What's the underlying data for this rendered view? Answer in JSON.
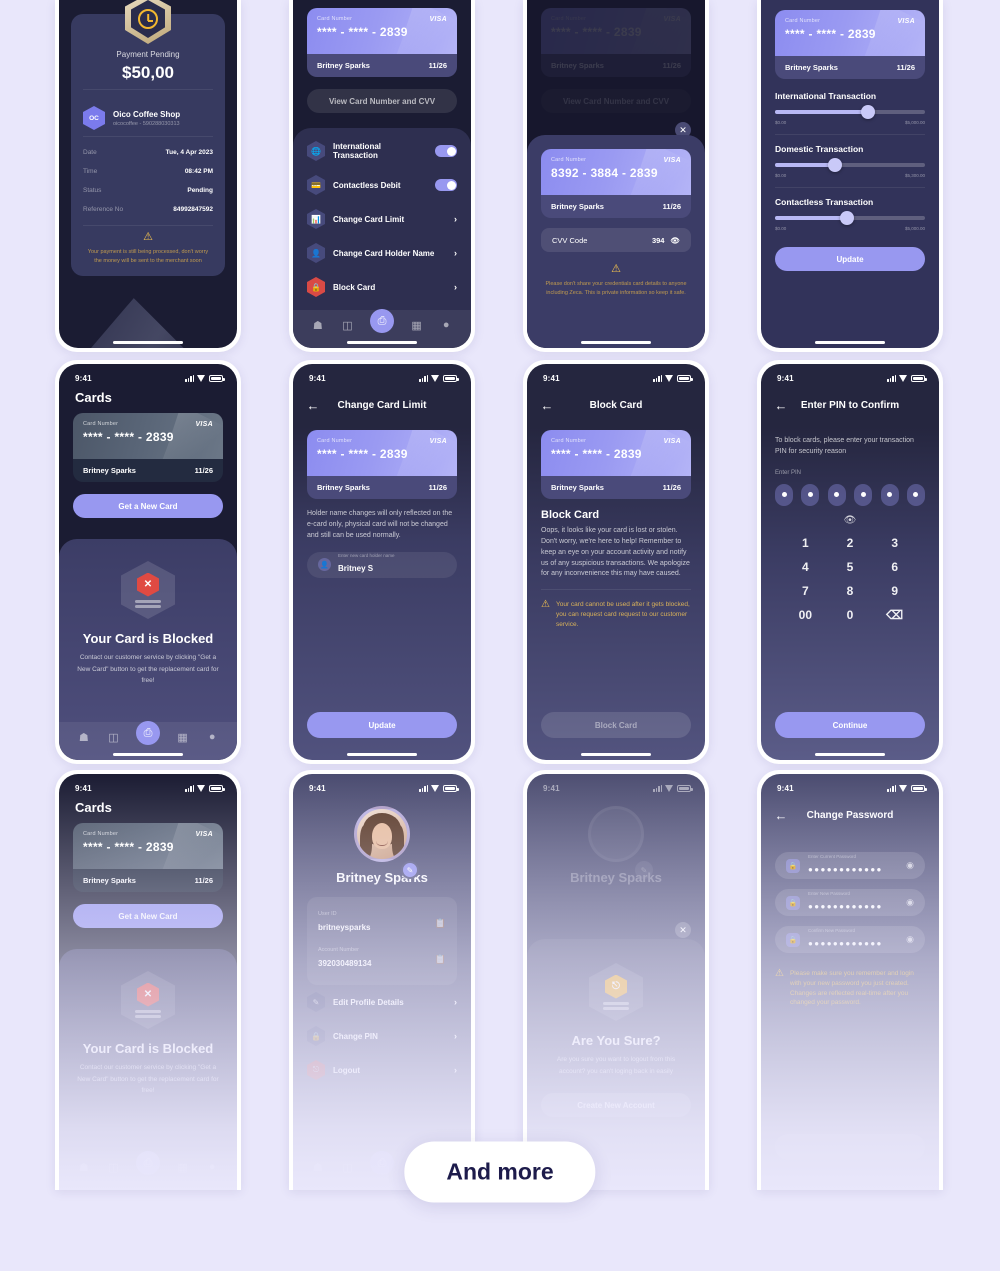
{
  "page": {
    "background": "#e9e7fb",
    "accent": "#9898f0",
    "and_more_label": "And more"
  },
  "common": {
    "status_time": "9:41",
    "card": {
      "label": "Card Number",
      "masked_number": "**** - **** - 2839",
      "holder": "Britney Sparks",
      "expiry": "11/26",
      "brand": "VISA"
    }
  },
  "screens": [
    {
      "id": "payment-pending",
      "receipt": {
        "status": "Payment Pending",
        "amount": "$50,00",
        "merchant_logo": "OC",
        "merchant_name": "Oico Coffee Shop",
        "merchant_sub": "oicocoffee - 590288030313",
        "rows": [
          {
            "key": "Date",
            "value": "Tue, 4 Apr 2023"
          },
          {
            "key": "Time",
            "value": "08:42 PM"
          },
          {
            "key": "Status",
            "value": "Pending"
          },
          {
            "key": "Reference No",
            "value": "84992847592"
          }
        ],
        "note": "Your payment is still being processed, don't worry the money will be sent to the merchant soon"
      }
    },
    {
      "id": "card-settings",
      "view_cvv_button": "View Card Number and CVV",
      "settings": [
        {
          "label": "International Transaction",
          "icon": "globe-icon",
          "control": "toggle",
          "on": true
        },
        {
          "label": "Contactless Debit",
          "icon": "contactless-icon",
          "control": "toggle",
          "on": true
        },
        {
          "label": "Change Card Limit",
          "icon": "chart-icon",
          "control": "chevron"
        },
        {
          "label": "Change Card Holder Name",
          "icon": "user-card-icon",
          "control": "chevron"
        },
        {
          "label": "Block Card",
          "icon": "block-icon",
          "control": "chevron",
          "danger": true
        }
      ],
      "tabs": [
        {
          "name": "home-icon",
          "glyph": "⌂"
        },
        {
          "name": "transactions-icon",
          "glyph": "≣"
        },
        {
          "name": "scan-icon",
          "glyph": "⬚"
        },
        {
          "name": "cards-icon",
          "glyph": "▤"
        },
        {
          "name": "profile-icon",
          "glyph": "●"
        }
      ]
    },
    {
      "id": "view-card-cvv",
      "view_cvv_button": "View Card Number and CVV",
      "revealed_number": "8392 - 3884 - 2839",
      "cvv_label": "CVV Code",
      "cvv_value": "394",
      "close_icon": "close-icon",
      "eye_icon": "eye-off-icon",
      "warning": "Please don't share your credentials card details to anyone including Zeca. This is private information so keep it safe."
    },
    {
      "id": "change-card-limit-sliders",
      "sliders": [
        {
          "title": "International Transaction",
          "min": "$0.00",
          "max": "$5,000.00",
          "position": 62
        },
        {
          "title": "Domestic Transaction",
          "min": "$0.00",
          "max": "$5,300.00",
          "position": 40
        },
        {
          "title": "Contactless Transaction",
          "min": "$0.00",
          "max": "$5,000.00",
          "position": 48
        }
      ],
      "update_button": "Update"
    },
    {
      "id": "cards-blocked",
      "page_title": "Cards",
      "get_new_card_button": "Get a New Card",
      "blocked_title": "Your Card is Blocked",
      "blocked_desc": "Contact our customer service by clicking \"Get a New Card\" button to get the replacement card for free!"
    },
    {
      "id": "change-card-limit",
      "nav_title": "Change Card Limit",
      "back_icon": "arrow-left-icon",
      "body": "Holder name changes will only reflected on the e-card only, physical card will not be changed and still can be used normally.",
      "input_placeholder": "Enter new card holder name",
      "input_value": "Britney S",
      "input_icon": "user-icon",
      "update_button": "Update"
    },
    {
      "id": "block-card",
      "nav_title": "Block Card",
      "back_icon": "arrow-left-icon",
      "heading": "Block Card",
      "body": "Oops, it looks like your card is lost or stolen. Don't worry, we're here to help! Remember to keep an eye on your account activity and notify us of any suspicious transactions. We apologize for any inconvenience this may have caused.",
      "warning": "Your card cannot be used after it gets blocked, you can request card request to our customer service.",
      "block_button": "Block Card"
    },
    {
      "id": "enter-pin",
      "nav_title": "Enter PIN to Confirm",
      "back_icon": "arrow-left-icon",
      "instruction": "To block cards, please enter your transaction PIN for security reason",
      "field_label": "Enter PIN",
      "pin_length": 6,
      "eye_icon": "eye-icon",
      "keypad": [
        "1",
        "2",
        "3",
        "4",
        "5",
        "6",
        "7",
        "8",
        "9",
        "00",
        "0",
        "⌫"
      ],
      "continue_button": "Continue"
    },
    {
      "id": "cards-blocked-faded",
      "page_title": "Cards",
      "get_new_card_button": "Get a New Card",
      "blocked_title": "Your Card is Blocked",
      "blocked_desc": "Contact our customer service by clicking \"Get a New Card\" button to get the replacement card for free!"
    },
    {
      "id": "profile",
      "name": "Britney Sparks",
      "edit_icon": "pencil-icon",
      "info": [
        {
          "key": "User ID",
          "value": "britneysparks",
          "action_icon": "copy-icon"
        },
        {
          "key": "Account Number",
          "value": "392030489134",
          "action_icon": "copy-icon"
        }
      ],
      "menu": [
        {
          "label": "Edit Profile Details",
          "icon": "pencil-icon"
        },
        {
          "label": "Change PIN",
          "icon": "lock-icon"
        },
        {
          "label": "Logout",
          "icon": "logout-icon"
        }
      ]
    },
    {
      "id": "logout-confirm",
      "name": "Britney Sparks",
      "close_icon": "close-icon",
      "title": "Are You Sure?",
      "desc": "Are you sure you want to logout from this account? you can't  loging back in easily",
      "button": "Create New Account"
    },
    {
      "id": "change-password",
      "nav_title": "Change Password",
      "back_icon": "arrow-left-icon",
      "fields": [
        {
          "placeholder": "Enter Current Password",
          "value": "●●●●●●●●●●●●",
          "lock_icon": "lock-icon",
          "eye_icon": "eye-icon"
        },
        {
          "placeholder": "Enter New Password",
          "value": "●●●●●●●●●●●●",
          "lock_icon": "lock-icon",
          "eye_icon": "eye-icon"
        },
        {
          "placeholder": "Confirm New Password",
          "value": "●●●●●●●●●●●●",
          "lock_icon": "lock-icon",
          "eye_icon": "eye-icon"
        }
      ],
      "warning": "Please make sure you remember and login with your new password you just created. Changes are reflected real-time after you changed your password."
    }
  ]
}
